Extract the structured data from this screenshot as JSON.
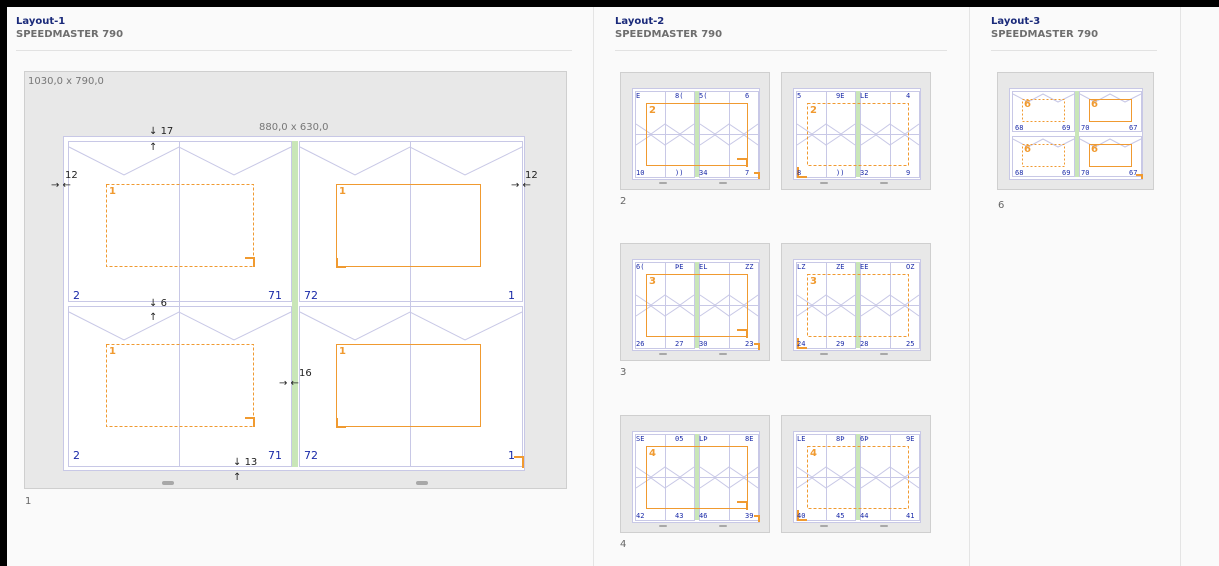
{
  "layouts": [
    {
      "title": "Layout-1",
      "machine": "SPEEDMASTER 790"
    },
    {
      "title": "Layout-2",
      "machine": "SPEEDMASTER 790"
    },
    {
      "title": "Layout-3",
      "machine": "SPEEDMASTER 790"
    }
  ],
  "main": {
    "press_size": "1030,0 x 790,0",
    "sheet_size": "880,0 x 630,0",
    "margin_top": "17",
    "margin_left": "12",
    "margin_right": "12",
    "gutter_horizontal": "6",
    "gutter_vertical": "16",
    "margin_bottom": "13",
    "signature_label": "1",
    "object_labels": [
      "1",
      "1",
      "1",
      "1"
    ],
    "page_numbers": [
      "2",
      "71",
      "72",
      "1",
      "2",
      "71",
      "72",
      "1"
    ]
  },
  "thumbs": [
    {
      "sig": "2",
      "top": [
        "E",
        "8(",
        "5(",
        "6"
      ],
      "bottom": [
        "10",
        "))",
        "34",
        "7"
      ],
      "obj": "2"
    },
    {
      "sig": "2b",
      "top": [
        "5",
        "9E",
        "LE",
        "4"
      ],
      "bottom": [
        "8",
        "))",
        "32",
        "9"
      ],
      "obj": "2"
    },
    {
      "sig": "3",
      "top": [
        "6(",
        "ÞE",
        "EL",
        "ZZ"
      ],
      "bottom": [
        "26",
        "27",
        "30",
        "23"
      ],
      "obj": "3"
    },
    {
      "sig": "3b",
      "top": [
        "LZ",
        "ZE",
        "EE",
        "OZ"
      ],
      "bottom": [
        "24",
        "29",
        "28",
        "25"
      ],
      "obj": "3"
    },
    {
      "sig": "4",
      "top": [
        "SE",
        "05",
        "LÞ",
        "8E"
      ],
      "bottom": [
        "42",
        "43",
        "46",
        "39"
      ],
      "obj": "4"
    },
    {
      "sig": "4b",
      "top": [
        "LE",
        "8Þ",
        "6Þ",
        "9E"
      ],
      "bottom": [
        "40",
        "45",
        "44",
        "41"
      ],
      "obj": "4"
    }
  ],
  "row_labels": [
    "2",
    "3",
    "4"
  ],
  "layout3": {
    "sig": "6",
    "obj": "6",
    "numbers": [
      "68",
      "69",
      "70",
      "67",
      "68",
      "69",
      "70",
      "67"
    ]
  },
  "colors": {
    "orange": "#f09a30",
    "page_blue": "#1a2aa8",
    "title_blue": "#1a2a7a",
    "rule": "#c8c8e6",
    "gutter_green": "#c9e6b8"
  }
}
